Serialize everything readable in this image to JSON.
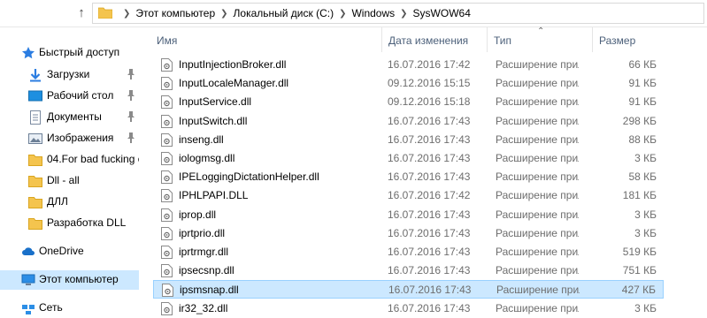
{
  "address": {
    "crumbs": [
      "Этот компьютер",
      "Локальный диск (C:)",
      "Windows",
      "SysWOW64"
    ]
  },
  "nav": {
    "quick_access": "Быстрый доступ",
    "items": [
      {
        "label": "Загрузки",
        "icon": "download-icon",
        "pinned": true
      },
      {
        "label": "Рабочий стол",
        "icon": "desktop-icon",
        "pinned": true
      },
      {
        "label": "Документы",
        "icon": "documents-icon",
        "pinned": true
      },
      {
        "label": "Изображения",
        "icon": "pictures-icon",
        "pinned": true
      },
      {
        "label": "04.For bad fucking c",
        "icon": "folder-icon",
        "pinned": false
      },
      {
        "label": "Dll - all",
        "icon": "folder-icon",
        "pinned": false
      },
      {
        "label": "ДЛЛ",
        "icon": "folder-icon",
        "pinned": false
      },
      {
        "label": "Разработка DLL",
        "icon": "folder-icon",
        "pinned": false
      }
    ],
    "onedrive": "OneDrive",
    "this_pc": "Этот компьютер",
    "network": "Сеть"
  },
  "columns": {
    "name": "Имя",
    "date": "Дата изменения",
    "type": "Тип",
    "size": "Размер"
  },
  "files": [
    {
      "name": "InputInjectionBroker.dll",
      "date": "16.07.2016 17:42",
      "type": "Расширение приложения",
      "size": "66 КБ"
    },
    {
      "name": "InputLocaleManager.dll",
      "date": "09.12.2016 15:15",
      "type": "Расширение приложения",
      "size": "91 КБ"
    },
    {
      "name": "InputService.dll",
      "date": "09.12.2016 15:18",
      "type": "Расширение приложения",
      "size": "91 КБ"
    },
    {
      "name": "InputSwitch.dll",
      "date": "16.07.2016 17:43",
      "type": "Расширение приложения",
      "size": "298 КБ"
    },
    {
      "name": "inseng.dll",
      "date": "16.07.2016 17:43",
      "type": "Расширение приложения",
      "size": "88 КБ"
    },
    {
      "name": "iologmsg.dll",
      "date": "16.07.2016 17:43",
      "type": "Расширение приложения",
      "size": "3 КБ"
    },
    {
      "name": "IPELoggingDictationHelper.dll",
      "date": "16.07.2016 17:43",
      "type": "Расширение приложения",
      "size": "58 КБ"
    },
    {
      "name": "IPHLPAPI.DLL",
      "date": "16.07.2016 17:42",
      "type": "Расширение приложения",
      "size": "181 КБ"
    },
    {
      "name": "iprop.dll",
      "date": "16.07.2016 17:43",
      "type": "Расширение приложения",
      "size": "3 КБ"
    },
    {
      "name": "iprtprio.dll",
      "date": "16.07.2016 17:43",
      "type": "Расширение приложения",
      "size": "3 КБ"
    },
    {
      "name": "iprtrmgr.dll",
      "date": "16.07.2016 17:43",
      "type": "Расширение приложения",
      "size": "519 КБ"
    },
    {
      "name": "ipsecsnp.dll",
      "date": "16.07.2016 17:43",
      "type": "Расширение приложения",
      "size": "751 КБ"
    },
    {
      "name": "ipsmsnap.dll",
      "date": "16.07.2016 17:43",
      "type": "Расширение приложения",
      "size": "427 КБ",
      "selected": true
    },
    {
      "name": "ir32_32.dll",
      "date": "16.07.2016 17:43",
      "type": "Расширение приложения",
      "size": "3 КБ"
    }
  ],
  "colors": {
    "selection_bg": "#cce8ff",
    "selection_border": "#99d1ff",
    "header_text": "#4c607a",
    "folder": "#f4c44e"
  }
}
